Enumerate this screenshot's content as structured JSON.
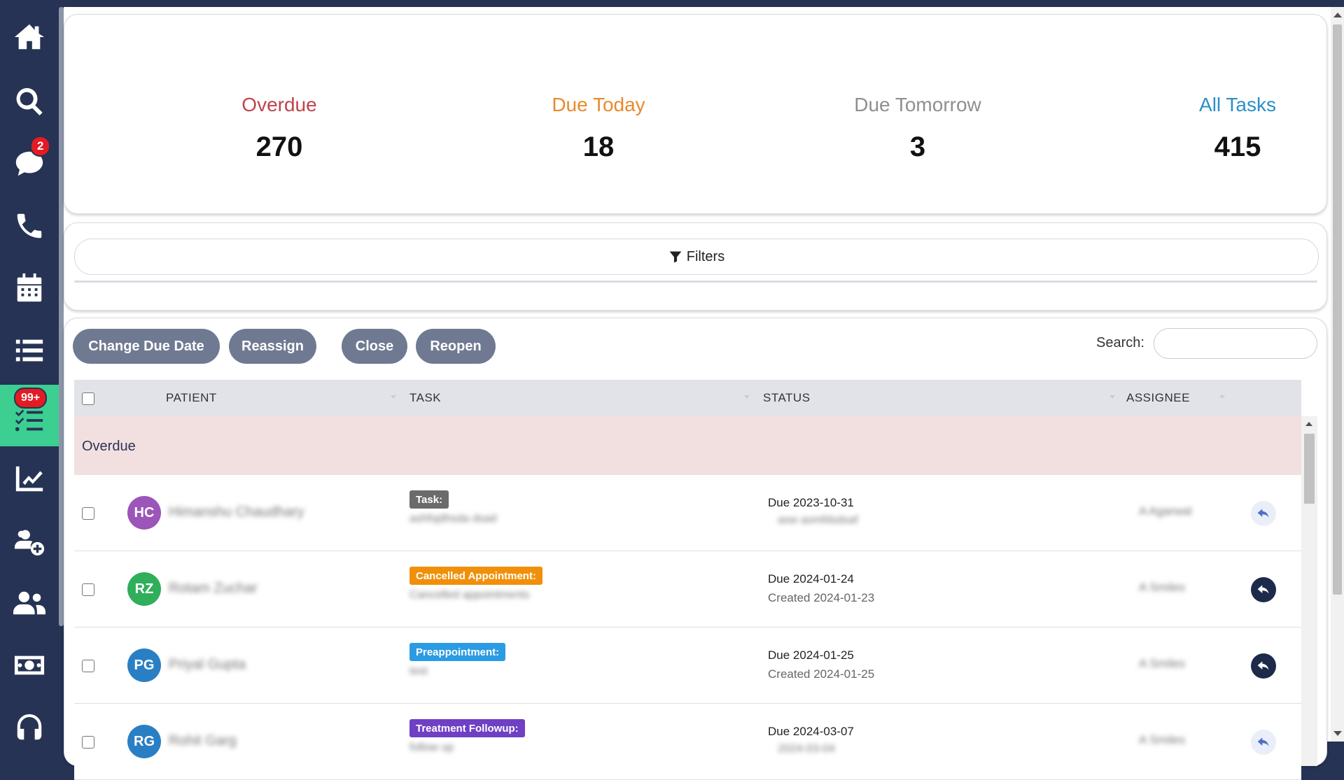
{
  "sidebar": {
    "items": [
      {
        "icon": "home-icon"
      },
      {
        "icon": "search-icon"
      },
      {
        "icon": "chat-icon",
        "badge": "2"
      },
      {
        "icon": "phone-icon"
      },
      {
        "icon": "calendar-icon"
      },
      {
        "icon": "list-icon"
      },
      {
        "icon": "tasks-icon",
        "badge": "99+",
        "active": true
      },
      {
        "icon": "chart-icon"
      },
      {
        "icon": "add-users-icon"
      },
      {
        "icon": "users-icon"
      },
      {
        "icon": "money-icon"
      },
      {
        "icon": "headset-icon"
      }
    ]
  },
  "stats": {
    "overdue": {
      "label": "Overdue",
      "value": "270",
      "color": "#c0434d"
    },
    "due_today": {
      "label": "Due Today",
      "value": "18",
      "color": "#e98a2d"
    },
    "due_tomorrow": {
      "label": "Due Tomorrow",
      "value": "3",
      "color": "#8f8f8f"
    },
    "all_tasks": {
      "label": "All Tasks",
      "value": "415",
      "color": "#2b8fc9"
    }
  },
  "filters": {
    "label": "Filters"
  },
  "actions": {
    "change_due_date": "Change Due Date",
    "reassign": "Reassign",
    "close": "Close",
    "reopen": "Reopen"
  },
  "search": {
    "label": "Search:",
    "value": ""
  },
  "table": {
    "columns": {
      "patient": "PATIENT",
      "task": "TASK",
      "status": "STATUS",
      "assignee": "ASSIGNEE"
    },
    "group_label": "Overdue",
    "rows": [
      {
        "initials": "HC",
        "avatar_color": "#9c55b8",
        "patient_name": "Himanshu Chaudhary",
        "tag": "Task:",
        "tag_color": "#6b6b6b",
        "task_desc": "ashfsjdhsda dsad",
        "due": "Due 2023-10-31",
        "created": "asw asmfdsdsaf",
        "assignee": "A Agarwal",
        "reply_style": "light"
      },
      {
        "initials": "RZ",
        "avatar_color": "#2fae5b",
        "patient_name": "Rotam Zuchar",
        "tag": "Cancelled Appointment:",
        "tag_color": "#f0900a",
        "task_desc": "Cancelled appointments",
        "due": "Due 2024-01-24",
        "created": "Created 2024-01-23",
        "assignee": "A Smiles",
        "reply_style": "dark"
      },
      {
        "initials": "PG",
        "avatar_color": "#2a7fc4",
        "patient_name": "Priyal Gupta",
        "tag": "Preappointment:",
        "tag_color": "#2b9be3",
        "task_desc": "test",
        "due": "Due 2024-01-25",
        "created": "Created 2024-01-25",
        "assignee": "A Smiles",
        "reply_style": "dark"
      },
      {
        "initials": "RG",
        "avatar_color": "#2a7fc4",
        "patient_name": "Rohit Garg",
        "tag": "Treatment Followup:",
        "tag_color": "#6f3fc4",
        "task_desc": "follow up",
        "due": "Due 2024-03-07",
        "created": "2024-03-04",
        "assignee": "A Smiles",
        "reply_style": "light"
      }
    ]
  }
}
